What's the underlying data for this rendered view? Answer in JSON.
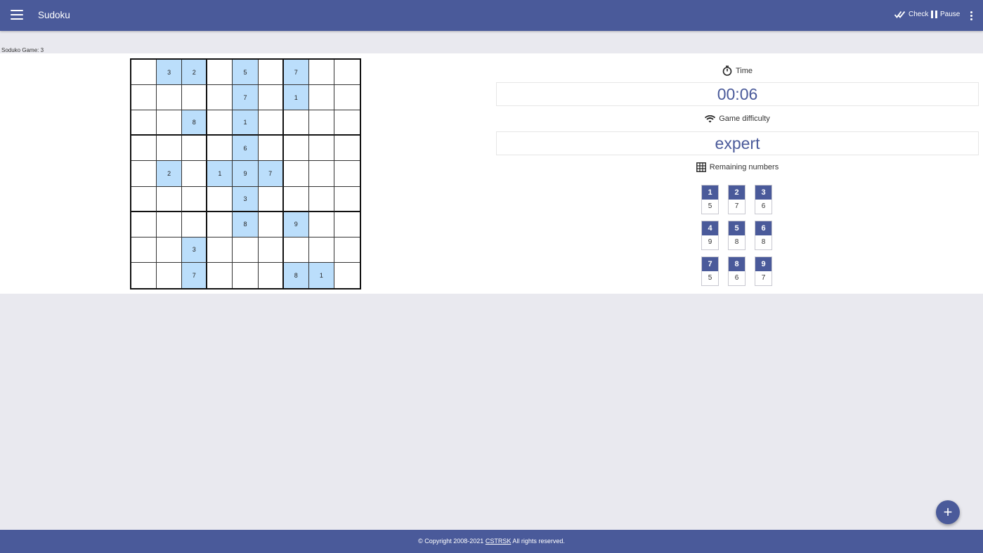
{
  "header": {
    "title": "Sudoku",
    "check_label": "Check",
    "pause_label": "Pause",
    "menu_icon": "hamburger-menu-icon",
    "more_icon": "more-vert-icon"
  },
  "game": {
    "label": "Soduko Game: 3"
  },
  "board": [
    [
      "",
      "3",
      "2",
      "",
      "5",
      "",
      "7",
      "",
      ""
    ],
    [
      "",
      "",
      "",
      "",
      "7",
      "",
      "1",
      "",
      ""
    ],
    [
      "",
      "",
      "8",
      "",
      "1",
      "",
      "",
      "",
      ""
    ],
    [
      "",
      "",
      "",
      "",
      "6",
      "",
      "",
      "",
      ""
    ],
    [
      "",
      "2",
      "",
      "1",
      "9",
      "7",
      "",
      "",
      ""
    ],
    [
      "",
      "",
      "",
      "",
      "3",
      "",
      "",
      "",
      ""
    ],
    [
      "",
      "",
      "",
      "",
      "8",
      "",
      "9",
      "",
      ""
    ],
    [
      "",
      "",
      "3",
      "",
      "",
      "",
      "",
      "",
      ""
    ],
    [
      "",
      "",
      "7",
      "",
      "",
      "",
      "8",
      "1",
      ""
    ]
  ],
  "time": {
    "label": "Time",
    "value": "00:06",
    "icon": "stopwatch-icon"
  },
  "difficulty": {
    "label": "Game difficulty",
    "value": "expert",
    "icon": "signal-icon"
  },
  "remaining": {
    "label": "Remaining numbers",
    "icon": "grid-icon",
    "items": [
      {
        "number": "1",
        "count": "5"
      },
      {
        "number": "2",
        "count": "7"
      },
      {
        "number": "3",
        "count": "6"
      },
      {
        "number": "4",
        "count": "9"
      },
      {
        "number": "5",
        "count": "8"
      },
      {
        "number": "6",
        "count": "8"
      },
      {
        "number": "7",
        "count": "5"
      },
      {
        "number": "8",
        "count": "6"
      },
      {
        "number": "9",
        "count": "7"
      }
    ]
  },
  "fab": {
    "label": "+"
  },
  "footer": {
    "prefix": "© Copyright 2008-2021",
    "link": "CSTRSK",
    "suffix": "All rights reserved."
  },
  "colors": {
    "primary": "#4a5a9a",
    "given_cell": "#bbdefb",
    "page_bg": "#e9e9ef"
  }
}
